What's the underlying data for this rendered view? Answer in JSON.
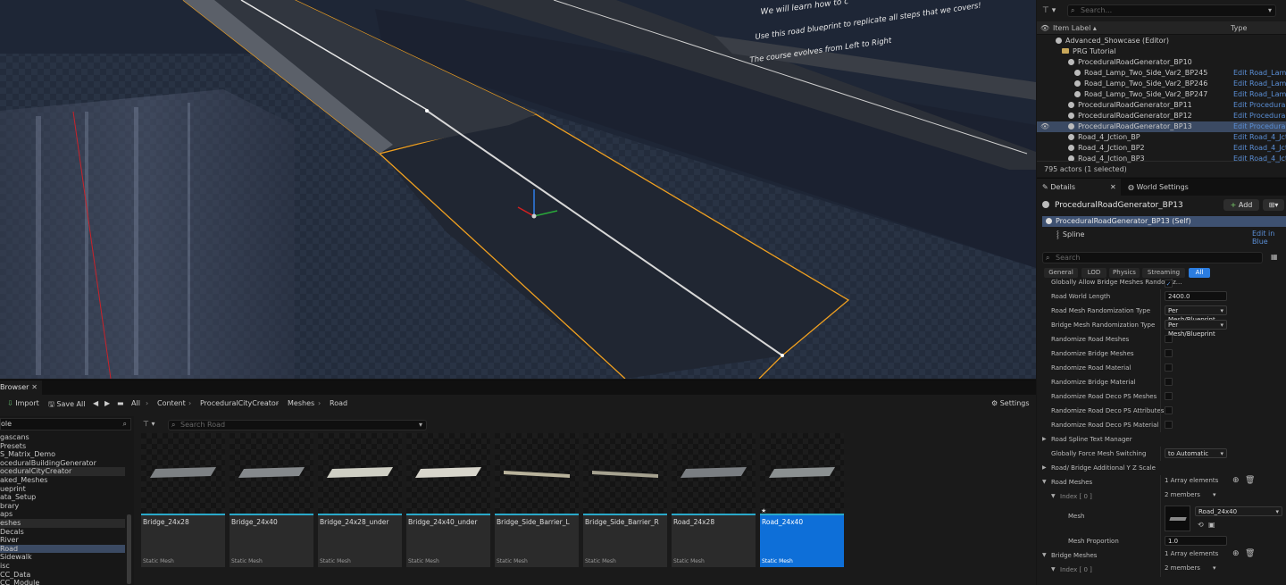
{
  "viewport": {
    "overlay_lines": [
      "We will learn how to c",
      "Use this road blueprint to replicate all steps that we covers!",
      "The course evolves from Left to Right"
    ]
  },
  "outliner": {
    "search_placeholder": "Search...",
    "col_label": "Item Label ▴",
    "col_type": "Type",
    "items": [
      {
        "label": "Advanced_Showcase (Editor)",
        "type": "",
        "kind": "level",
        "indent": 1
      },
      {
        "label": "PRG Tutorial",
        "type": "",
        "kind": "folder",
        "indent": 2
      },
      {
        "label": "ProceduralRoadGenerator_BP10",
        "type": "",
        "kind": "actor",
        "indent": 3
      },
      {
        "label": "Road_Lamp_Two_Side_Var2_BP245",
        "type": "Edit Road_Lamp_",
        "kind": "actor",
        "indent": 4
      },
      {
        "label": "Road_Lamp_Two_Side_Var2_BP246",
        "type": "Edit Road_Lamp_",
        "kind": "actor",
        "indent": 4
      },
      {
        "label": "Road_Lamp_Two_Side_Var2_BP247",
        "type": "Edit Road_Lamp_",
        "kind": "actor",
        "indent": 4
      },
      {
        "label": "ProceduralRoadGenerator_BP11",
        "type": "Edit ProceduralR",
        "kind": "actor",
        "indent": 3
      },
      {
        "label": "ProceduralRoadGenerator_BP12",
        "type": "Edit ProceduralR",
        "kind": "actor",
        "indent": 3
      },
      {
        "label": "ProceduralRoadGenerator_BP13",
        "type": "Edit ProceduralR",
        "kind": "actor",
        "indent": 3,
        "selected": true
      },
      {
        "label": "Road_4_Jction_BP",
        "type": "Edit Road_4_Jctio",
        "kind": "actor",
        "indent": 3
      },
      {
        "label": "Road_4_Jction_BP2",
        "type": "Edit Road_4_Jctio",
        "kind": "actor",
        "indent": 3
      },
      {
        "label": "Road_4_Jction_BP3",
        "type": "Edit Road_4_Jctio",
        "kind": "actor",
        "indent": 3
      }
    ],
    "count": "795 actors (1 selected)"
  },
  "details": {
    "tab_details": "Details",
    "tab_world": "World Settings",
    "actor_name": "ProceduralRoadGenerator_BP13",
    "add_label": "Add",
    "self_label": "ProceduralRoadGenerator_BP13 (Self)",
    "component": "Spline",
    "edit_link": "Edit in Blue",
    "search_placeholder": "Search",
    "categories": [
      "General",
      "LOD",
      "Physics",
      "Streaming",
      "All"
    ],
    "active_category": "All",
    "props": {
      "p0": "Globally Allow Bridge Meshes Randomiz...",
      "p1": "Road World Length",
      "p1v": "2400.0",
      "p2": "Road Mesh Randomization Type",
      "p2v": "Per Mesh/Blueprint",
      "p3": "Bridge Mesh Randomization Type",
      "p3v": "Per Mesh/Blueprint",
      "p4": "Randomize Road Meshes",
      "p5": "Randomize Bridge Meshes",
      "p6": "Randomize Road Material",
      "p7": "Randomize Bridge Material",
      "p8": "Randomize Road Deco PS Meshes",
      "p9": "Randomize Road Deco PS Attributes",
      "p10": "Randomize Road Deco PS Material",
      "p11": "Road Spline Text Manager",
      "p12": "Globally Force Mesh Switching",
      "p12v": "to Automatic",
      "p13": "Road/ Bridge Additional Y Z Scale",
      "p14": "Road Meshes",
      "p14v": "1 Array elements",
      "p15": "Index [ 0 ]",
      "p15v": "2 members",
      "p16": "Mesh",
      "p16v": "Road_24x40",
      "p17": "Mesh Proportion",
      "p17v": "1.0",
      "p18": "Bridge Meshes",
      "p18v": "1 Array elements",
      "p19": "Index [ 0 ]",
      "p19v": "2 members"
    }
  },
  "content_browser": {
    "tab_label": "Browser",
    "import_label": "Import",
    "save_all_label": "Save All",
    "breadcrumb": [
      "All",
      "Content",
      "ProceduralCityCreator",
      "Meshes",
      "Road"
    ],
    "settings_label": "Settings",
    "left_header": "ole",
    "search_placeholder": "Search Road",
    "tree": [
      {
        "label": "gascans"
      },
      {
        "label": "Presets"
      },
      {
        "label": "S_Matrix_Demo"
      },
      {
        "label": "oceduralBuildingGenerator"
      },
      {
        "label": "oceduralCityCreator",
        "hl": true
      },
      {
        "label": "aked_Meshes"
      },
      {
        "label": "ueprint"
      },
      {
        "label": "ata_Setup"
      },
      {
        "label": "brary"
      },
      {
        "label": "aps"
      },
      {
        "label": "eshes",
        "hl": true
      },
      {
        "label": "Decals"
      },
      {
        "label": "River"
      },
      {
        "label": "Road",
        "selected": true
      },
      {
        "label": "Sidewalk"
      },
      {
        "label": "isc"
      },
      {
        "label": "CC_Data"
      },
      {
        "label": "CC_Module"
      }
    ],
    "assets": [
      {
        "name": "Bridge_24x28",
        "type": "Static Mesh"
      },
      {
        "name": "Bridge_24x40",
        "type": "Static Mesh"
      },
      {
        "name": "Bridge_24x28_under",
        "type": "Static Mesh"
      },
      {
        "name": "Bridge_24x40_under",
        "type": "Static Mesh"
      },
      {
        "name": "Bridge_Side_Barrier_L",
        "type": "Static Mesh"
      },
      {
        "name": "Bridge_Side_Barrier_R",
        "type": "Static Mesh"
      },
      {
        "name": "Road_24x28",
        "type": "Static Mesh"
      },
      {
        "name": "Road_24x40",
        "type": "Static Mesh",
        "selected": true
      }
    ]
  },
  "colors": {
    "accent": "#0e6fd8",
    "selection": "#3b4a63",
    "highlight_outline": "#f0a020",
    "link": "#5b8fd6"
  }
}
